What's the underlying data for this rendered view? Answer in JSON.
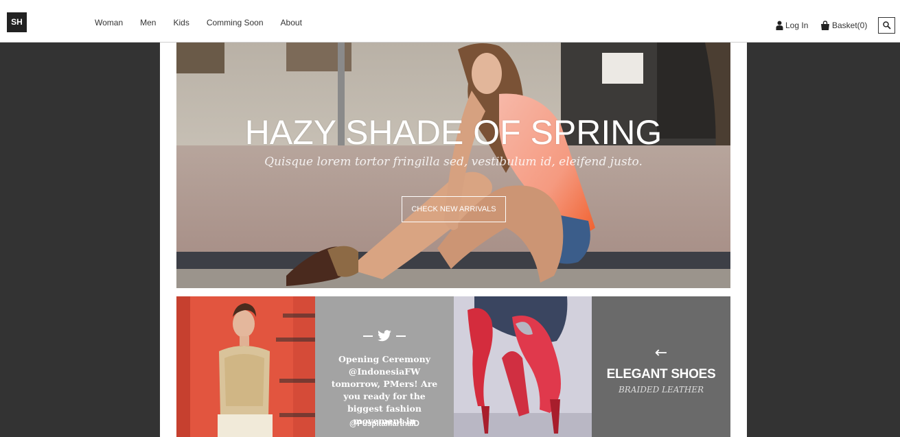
{
  "header": {
    "logo_text": "SH",
    "nav": [
      "Woman",
      "Men",
      "Kids",
      "Comming Soon",
      "About"
    ],
    "login_label": "Log In",
    "basket_label": "Basket(0)"
  },
  "hero": {
    "title": "HAZY SHADE OF SPRING",
    "subtitle": "Quisque lorem tortor fringilla sed, vestibulum id, eleifend justo.",
    "button_label": "CHECK NEW ARRIVALS"
  },
  "tiles": {
    "tweet": {
      "text": "Opening Ceremony @IndonesiaFW tomorrow, PMers! Are you ready for the biggest fashion movement in",
      "handle": "@PuspitaMarthaID"
    },
    "shoes": {
      "title": "ELEGANT SHOES",
      "subtitle": "BRAIDED LEATHER"
    }
  },
  "colors": {
    "page_bg": "#333333",
    "tweet_tile": "#a3a3a3",
    "shoes_tile": "#6a6a6a"
  },
  "icons": [
    "user-icon",
    "shopping-bag-icon",
    "search-icon",
    "twitter-icon",
    "arrow-left-icon"
  ]
}
